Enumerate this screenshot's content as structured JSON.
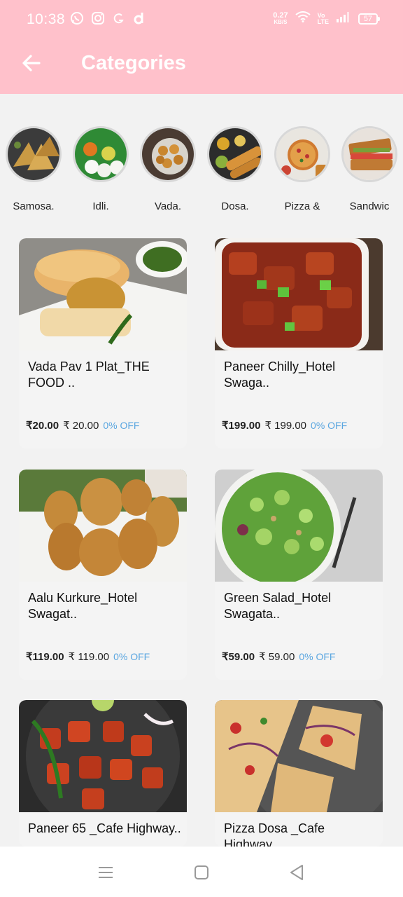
{
  "status_bar": {
    "time": "10:38",
    "net_speed": "0.27",
    "net_unit": "KB/S",
    "volte_top": "Vo",
    "volte_bottom": "LTE",
    "battery": "57"
  },
  "header": {
    "title": "Categories"
  },
  "categories": [
    {
      "label": "Samosa."
    },
    {
      "label": "Idli."
    },
    {
      "label": "Vada."
    },
    {
      "label": "Dosa."
    },
    {
      "label": "Pizza &"
    },
    {
      "label": "Sandwic"
    }
  ],
  "products": [
    {
      "name": "Vada Pav 1 Plat_THE FOOD ..",
      "price": "₹20.00",
      "mrp": "₹ 20.00",
      "discount": "0% OFF"
    },
    {
      "name": "Paneer Chilly_Hotel Swaga..",
      "price": "₹199.00",
      "mrp": "₹ 199.00",
      "discount": "0% OFF"
    },
    {
      "name": "Aalu Kurkure_Hotel Swagat..",
      "price": "₹119.00",
      "mrp": "₹ 119.00",
      "discount": "0% OFF"
    },
    {
      "name": "Green Salad_Hotel Swagata..",
      "price": "₹59.00",
      "mrp": "₹ 59.00",
      "discount": "0% OFF"
    },
    {
      "name": "Paneer 65 _Cafe Highway..",
      "price": "",
      "mrp": "",
      "discount": ""
    },
    {
      "name": "Pizza Dosa _Cafe Highway..",
      "price": "",
      "mrp": "",
      "discount": ""
    }
  ],
  "colors": {
    "header_bg": "#ffc1cb",
    "discount_text": "#5aa6e0",
    "page_bg": "#f2f2f2"
  },
  "icons": {
    "back": "arrow-left-icon",
    "nav_recent": "menu-lines-icon",
    "nav_home": "square-icon",
    "nav_back": "triangle-back-icon"
  }
}
